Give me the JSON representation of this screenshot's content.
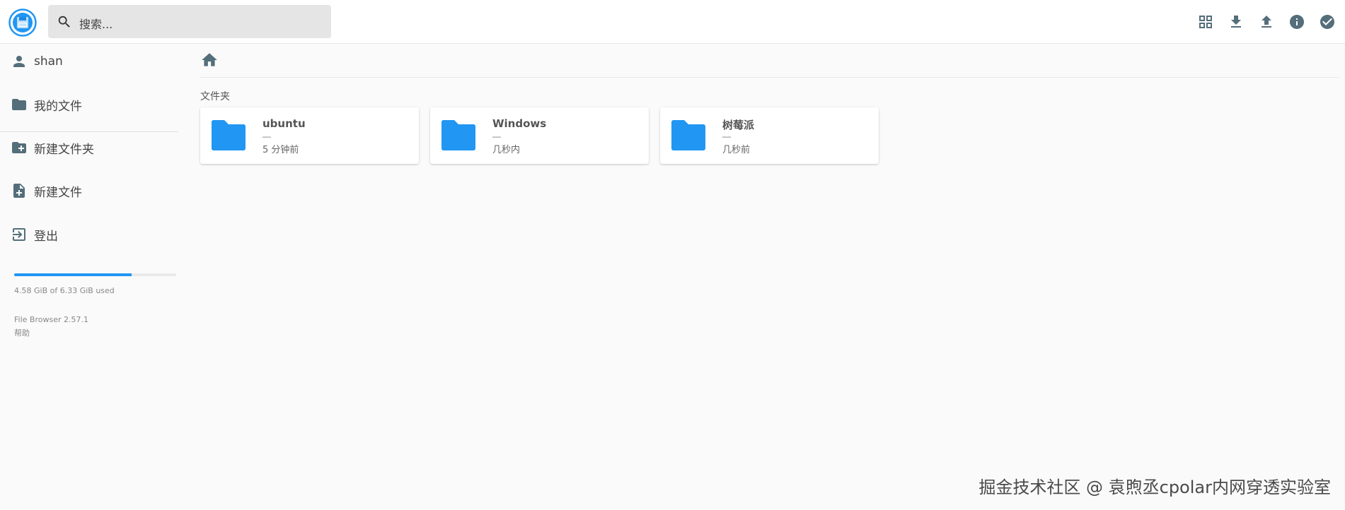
{
  "header": {
    "search_placeholder": "搜索...",
    "logo_icon": "floppy-disk-icon",
    "actions": [
      {
        "name": "grid-view-icon"
      },
      {
        "name": "download-icon"
      },
      {
        "name": "upload-icon"
      },
      {
        "name": "info-icon"
      },
      {
        "name": "check-circle-icon"
      }
    ]
  },
  "sidebar": {
    "user": "shan",
    "my_files": "我的文件",
    "new_folder": "新建文件夹",
    "new_file": "新建文件",
    "logout": "登出",
    "usage_text": "4.58 GiB of 6.33 GiB used",
    "usage_fraction": 0.723,
    "version": "File Browser 2.57.1",
    "help": "帮助"
  },
  "main": {
    "section_title": "文件夹",
    "folders": [
      {
        "name": "ubuntu",
        "size": "—",
        "modified": "5 分钟前"
      },
      {
        "name": "Windows",
        "size": "—",
        "modified": "几秒内"
      },
      {
        "name": "树莓派",
        "size": "—",
        "modified": "几秒前"
      }
    ]
  },
  "watermark": "掘金技术社区 @ 袁煦丞cpolar内网穿透实验室",
  "colors": {
    "accent": "#2196f3",
    "icon": "#546e7a",
    "background": "#fafafa"
  }
}
